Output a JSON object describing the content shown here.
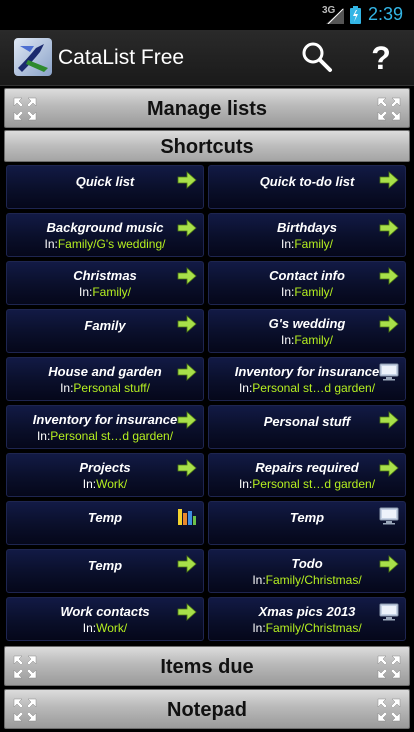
{
  "status_bar": {
    "network": "3G",
    "time": "2:39"
  },
  "action_bar": {
    "title": "CataList Free",
    "search_icon": "search-icon",
    "help_icon": "help-icon",
    "help_glyph": "?"
  },
  "sections": {
    "manage_lists": "Manage lists",
    "shortcuts": "Shortcuts",
    "items_due": "Items due",
    "notepad": "Notepad"
  },
  "shortcuts": [
    {
      "title": "Quick list",
      "in": "",
      "path": "",
      "icon": "arrow-right-icon"
    },
    {
      "title": "Quick to-do list",
      "in": "",
      "path": "",
      "icon": "arrow-right-icon"
    },
    {
      "title": "Background music",
      "in": "In:",
      "path": "Family/G's wedding/",
      "icon": "arrow-right-icon"
    },
    {
      "title": "Birthdays",
      "in": "In:",
      "path": "Family/",
      "icon": "arrow-right-icon"
    },
    {
      "title": "Christmas",
      "in": "In:",
      "path": "Family/",
      "icon": "arrow-right-icon"
    },
    {
      "title": "Contact info",
      "in": "In:",
      "path": "Family/",
      "icon": "arrow-right-icon"
    },
    {
      "title": "Family",
      "in": "",
      "path": "",
      "icon": "arrow-right-icon"
    },
    {
      "title": "G's wedding",
      "in": "In:",
      "path": "Family/",
      "icon": "arrow-right-icon"
    },
    {
      "title": "House and garden",
      "in": "In:",
      "path": "Personal stuff/",
      "icon": "arrow-right-icon"
    },
    {
      "title": "Inventory for insurance",
      "in": "In:",
      "path": "Personal st…d garden/",
      "icon": "monitor-icon"
    },
    {
      "title": "Inventory for insurance",
      "in": "In:",
      "path": "Personal st…d garden/",
      "icon": "arrow-right-icon"
    },
    {
      "title": "Personal stuff",
      "in": "",
      "path": "",
      "icon": "arrow-right-icon"
    },
    {
      "title": "Projects",
      "in": "In:",
      "path": "Work/",
      "icon": "arrow-right-icon"
    },
    {
      "title": "Repairs required",
      "in": "In:",
      "path": "Personal st…d garden/",
      "icon": "arrow-right-icon"
    },
    {
      "title": "Temp",
      "in": "",
      "path": "",
      "icon": "bar-chart-icon"
    },
    {
      "title": "Temp",
      "in": "",
      "path": "",
      "icon": "monitor-icon"
    },
    {
      "title": "Temp",
      "in": "",
      "path": "",
      "icon": "arrow-right-icon"
    },
    {
      "title": "Todo",
      "in": "In:",
      "path": "Family/Christmas/",
      "icon": "arrow-right-icon"
    },
    {
      "title": "Work contacts",
      "in": "In:",
      "path": "Work/",
      "icon": "arrow-right-icon"
    },
    {
      "title": "Xmas pics 2013",
      "in": "In:",
      "path": "Family/Christmas/",
      "icon": "monitor-icon"
    }
  ],
  "colors": {
    "accent": "#33b5e5",
    "path": "#b6f020",
    "arrow": "#a8e04a"
  }
}
